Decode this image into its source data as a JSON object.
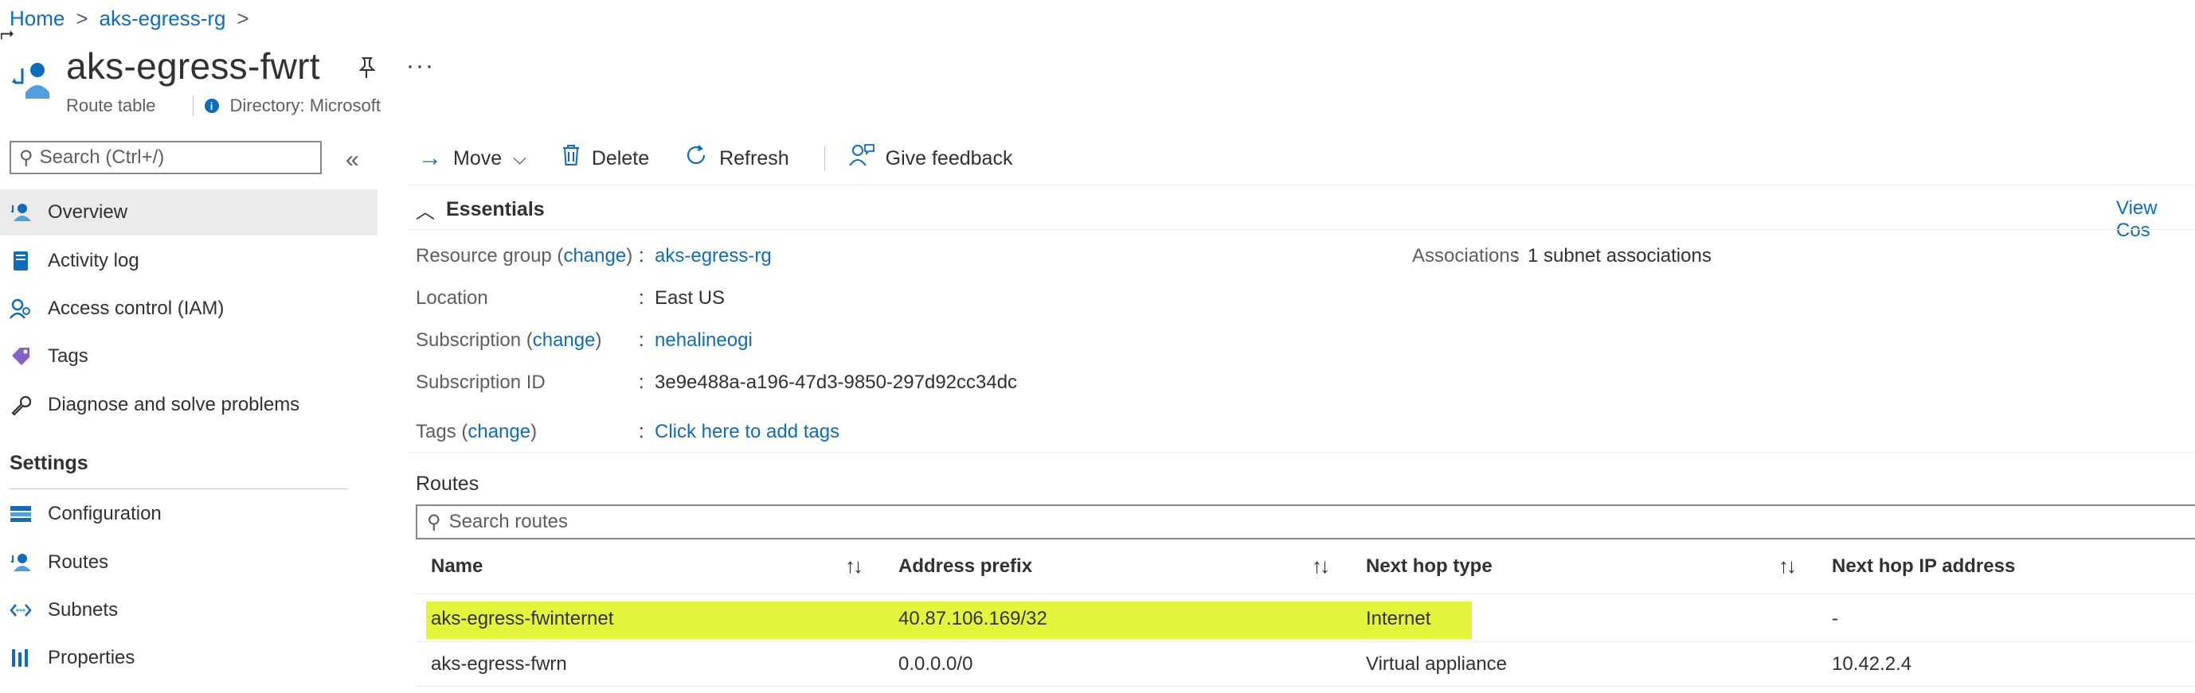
{
  "breadcrumb": {
    "items": [
      "Home",
      "aks-egress-rg"
    ],
    "separator": ">"
  },
  "header": {
    "title": "aks-egress-fwrt",
    "resource_type": "Route table",
    "directory": "Directory: Microsoft",
    "more": "···"
  },
  "sidebar": {
    "search_placeholder": "Search (Ctrl+/)",
    "collapse": "«",
    "items": [
      {
        "label": "Overview",
        "icon": "overview-icon"
      },
      {
        "label": "Activity log",
        "icon": "activity-log-icon"
      },
      {
        "label": "Access control (IAM)",
        "icon": "iam-icon"
      },
      {
        "label": "Tags",
        "icon": "tag-icon"
      },
      {
        "label": "Diagnose and solve problems",
        "icon": "wrench-icon"
      }
    ],
    "settings_heading": "Settings",
    "settings_items": [
      {
        "label": "Configuration",
        "icon": "configuration-icon"
      },
      {
        "label": "Routes",
        "icon": "routes-icon"
      },
      {
        "label": "Subnets",
        "icon": "subnets-icon"
      },
      {
        "label": "Properties",
        "icon": "properties-icon"
      }
    ]
  },
  "toolbar": {
    "move": "Move",
    "delete": "Delete",
    "refresh": "Refresh",
    "feedback": "Give feedback"
  },
  "essentials": {
    "heading": "Essentials",
    "view_cost": "View Cos",
    "resource_group_label": "Resource group (",
    "resource_group_change": "change",
    "resource_group_value": "aks-egress-rg",
    "location_label": "Location",
    "location_value": "East US",
    "subscription_label": "Subscription (",
    "subscription_change": "change",
    "subscription_value": "nehalineogi",
    "subscription_id_label": "Subscription ID",
    "subscription_id_value": "3e9e488a-a196-47d3-9850-297d92cc34dc",
    "tags_label": "Tags (",
    "tags_change": "change",
    "tags_value": "Click here to add tags",
    "associations_label": "Associations",
    "associations_value": "1 subnet associations",
    "colon": ":",
    "close_paren": ")"
  },
  "routes": {
    "heading": "Routes",
    "search_placeholder": "Search routes",
    "columns": [
      "Name",
      "Address prefix",
      "Next hop type",
      "Next hop IP address"
    ],
    "rows": [
      {
        "name": "aks-egress-fwinternet",
        "prefix": "40.87.106.169/32",
        "hop_type": "Internet",
        "hop_ip": "-"
      },
      {
        "name": "aks-egress-fwrn",
        "prefix": "0.0.0.0/0",
        "hop_type": "Virtual appliance",
        "hop_ip": "10.42.2.4"
      }
    ]
  },
  "colors": {
    "accent": "#0f6cbd",
    "highlight": "#e4f43a",
    "active_nav": "#edebe9"
  }
}
